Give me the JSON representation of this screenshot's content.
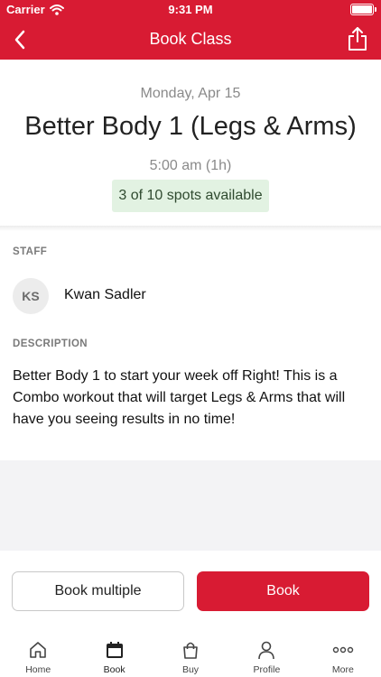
{
  "status_bar": {
    "carrier": "Carrier",
    "time": "9:31 PM"
  },
  "nav": {
    "title": "Book Class"
  },
  "class_info": {
    "date": "Monday, Apr 15",
    "name": "Better Body 1 (Legs & Arms)",
    "time": "5:00 am (1h)",
    "spots": "3 of 10 spots available"
  },
  "staff": {
    "section_label": "STAFF",
    "initials": "KS",
    "name": "Kwan Sadler"
  },
  "description": {
    "section_label": "DESCRIPTION",
    "text": "Better Body 1 to start your week off Right! This is a Combo workout that will target Legs & Arms that will have you seeing results in no time!"
  },
  "actions": {
    "book_multiple": "Book multiple",
    "book": "Book"
  },
  "tabs": [
    {
      "label": "Home",
      "icon": "home-icon"
    },
    {
      "label": "Book",
      "icon": "calendar-icon"
    },
    {
      "label": "Buy",
      "icon": "shopping-bag-icon"
    },
    {
      "label": "Profile",
      "icon": "person-icon"
    },
    {
      "label": "More",
      "icon": "more-dots-icon"
    }
  ],
  "colors": {
    "brand": "#d81b33",
    "spots_bg": "#e2f2e2"
  }
}
